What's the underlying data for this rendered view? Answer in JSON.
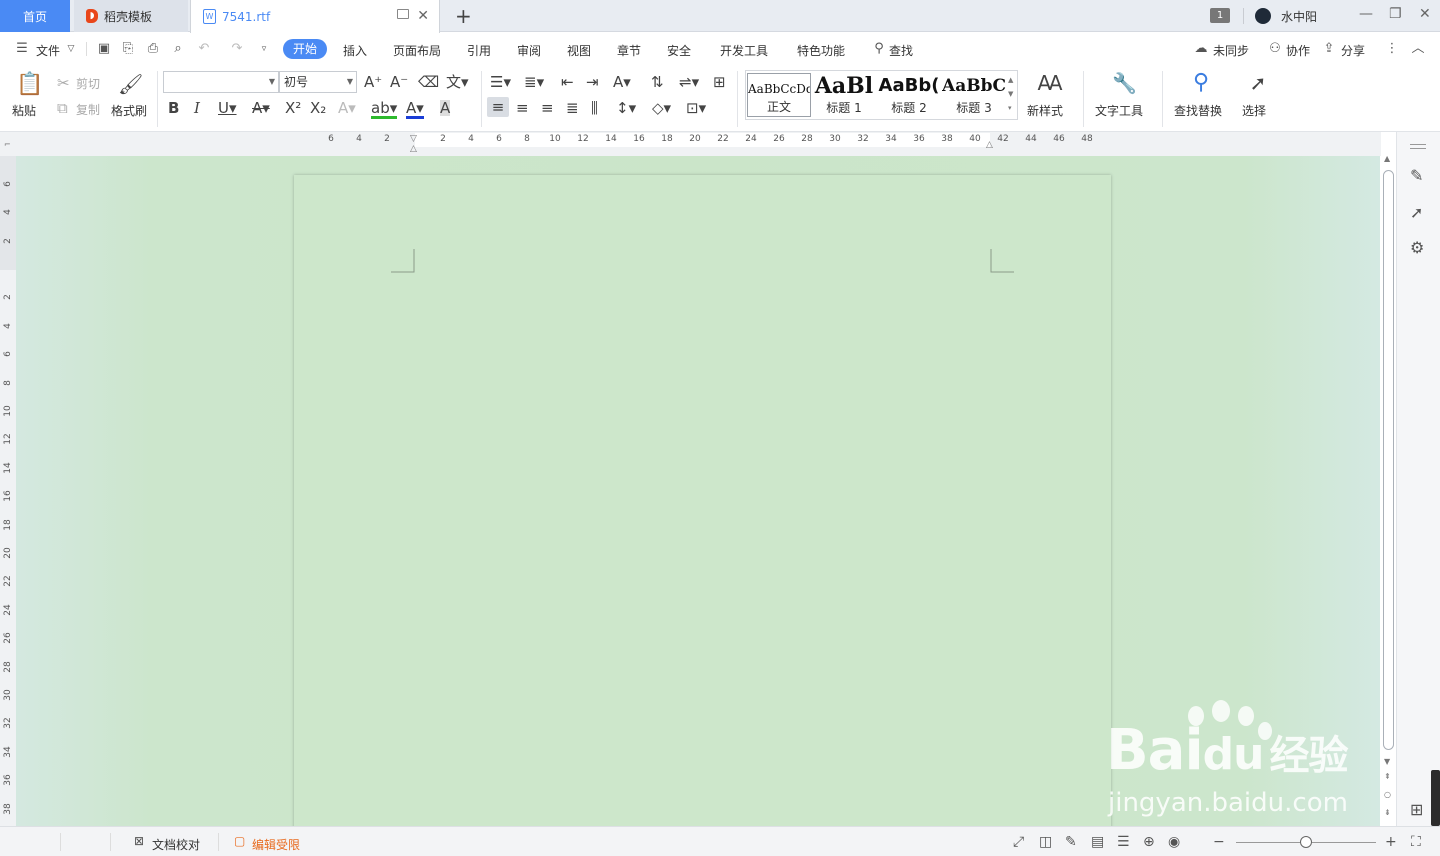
{
  "tabs": {
    "home": "首页",
    "template": "稻壳模板",
    "document": "7541.rtf",
    "add": "+"
  },
  "window": {
    "badge": "1",
    "user": "水中阳",
    "minimize": "—",
    "restore": "❐",
    "close": "✕"
  },
  "menubar": {
    "file": "文件",
    "tabs": [
      "开始",
      "插入",
      "页面布局",
      "引用",
      "审阅",
      "视图",
      "章节",
      "安全",
      "开发工具",
      "特色功能"
    ],
    "search": "查找",
    "sync": "未同步",
    "collab": "协作",
    "share": "分享"
  },
  "ribbon": {
    "paste": "粘贴",
    "cut": "剪切",
    "copy": "复制",
    "format_painter": "格式刷",
    "font_name": "",
    "font_size": "初号",
    "styles": [
      {
        "preview": "AaBbCcDd",
        "name": "正文"
      },
      {
        "preview": "AaBl",
        "name": "标题 1"
      },
      {
        "preview": "AaBb(",
        "name": "标题 2"
      },
      {
        "preview": "AaBbC",
        "name": "标题 3"
      }
    ],
    "new_style": "新样式",
    "text_tools": "文字工具",
    "find_replace": "查找替换",
    "select": "选择"
  },
  "ruler": {
    "h_left": [
      "6",
      "4",
      "2"
    ],
    "h_right": [
      "2",
      "4",
      "6",
      "8",
      "10",
      "12",
      "14",
      "16",
      "18",
      "20",
      "22",
      "24",
      "26",
      "28",
      "30",
      "32",
      "34",
      "36",
      "38",
      "40",
      "42",
      "44",
      "46",
      "48"
    ],
    "v_top": [
      "6",
      "4",
      "2"
    ],
    "v_main": [
      "2",
      "4",
      "6",
      "8",
      "10",
      "12",
      "14",
      "16",
      "18",
      "20",
      "22",
      "24",
      "26",
      "28",
      "30",
      "32",
      "34",
      "36",
      "38"
    ]
  },
  "statusbar": {
    "proofread": "文档校对",
    "restricted": "编辑受限"
  },
  "watermark": {
    "brand": "Bai",
    "brand2": "du",
    "jy": "经验",
    "url": "jingyan.baidu.com"
  },
  "colors": {
    "accent": "#4a8af4",
    "workspace": "#cbe5c9",
    "page": "#cde7cb",
    "restricted": "#e86a1e"
  }
}
